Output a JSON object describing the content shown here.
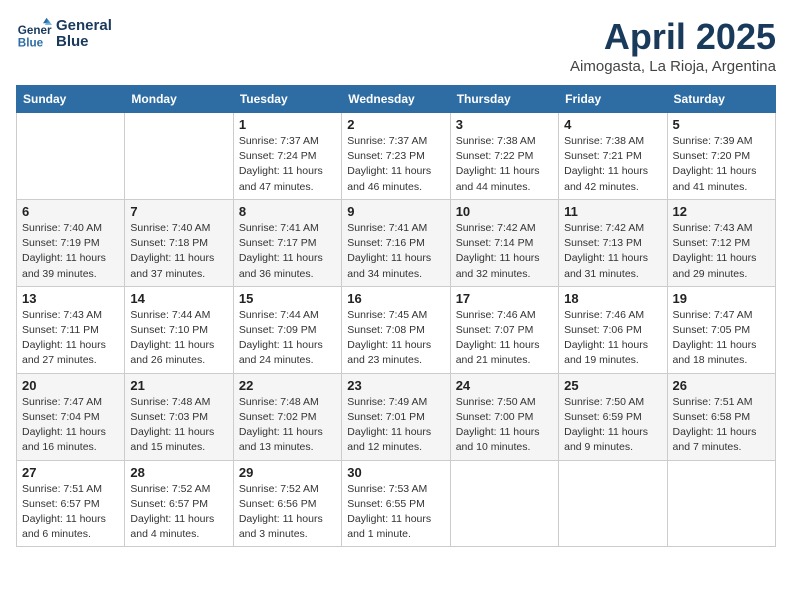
{
  "logo": {
    "line1": "General",
    "line2": "Blue"
  },
  "title": "April 2025",
  "subtitle": "Aimogasta, La Rioja, Argentina",
  "days_of_week": [
    "Sunday",
    "Monday",
    "Tuesday",
    "Wednesday",
    "Thursday",
    "Friday",
    "Saturday"
  ],
  "weeks": [
    [
      {
        "day": "",
        "info": ""
      },
      {
        "day": "",
        "info": ""
      },
      {
        "day": "1",
        "info": "Sunrise: 7:37 AM\nSunset: 7:24 PM\nDaylight: 11 hours and 47 minutes."
      },
      {
        "day": "2",
        "info": "Sunrise: 7:37 AM\nSunset: 7:23 PM\nDaylight: 11 hours and 46 minutes."
      },
      {
        "day": "3",
        "info": "Sunrise: 7:38 AM\nSunset: 7:22 PM\nDaylight: 11 hours and 44 minutes."
      },
      {
        "day": "4",
        "info": "Sunrise: 7:38 AM\nSunset: 7:21 PM\nDaylight: 11 hours and 42 minutes."
      },
      {
        "day": "5",
        "info": "Sunrise: 7:39 AM\nSunset: 7:20 PM\nDaylight: 11 hours and 41 minutes."
      }
    ],
    [
      {
        "day": "6",
        "info": "Sunrise: 7:40 AM\nSunset: 7:19 PM\nDaylight: 11 hours and 39 minutes."
      },
      {
        "day": "7",
        "info": "Sunrise: 7:40 AM\nSunset: 7:18 PM\nDaylight: 11 hours and 37 minutes."
      },
      {
        "day": "8",
        "info": "Sunrise: 7:41 AM\nSunset: 7:17 PM\nDaylight: 11 hours and 36 minutes."
      },
      {
        "day": "9",
        "info": "Sunrise: 7:41 AM\nSunset: 7:16 PM\nDaylight: 11 hours and 34 minutes."
      },
      {
        "day": "10",
        "info": "Sunrise: 7:42 AM\nSunset: 7:14 PM\nDaylight: 11 hours and 32 minutes."
      },
      {
        "day": "11",
        "info": "Sunrise: 7:42 AM\nSunset: 7:13 PM\nDaylight: 11 hours and 31 minutes."
      },
      {
        "day": "12",
        "info": "Sunrise: 7:43 AM\nSunset: 7:12 PM\nDaylight: 11 hours and 29 minutes."
      }
    ],
    [
      {
        "day": "13",
        "info": "Sunrise: 7:43 AM\nSunset: 7:11 PM\nDaylight: 11 hours and 27 minutes."
      },
      {
        "day": "14",
        "info": "Sunrise: 7:44 AM\nSunset: 7:10 PM\nDaylight: 11 hours and 26 minutes."
      },
      {
        "day": "15",
        "info": "Sunrise: 7:44 AM\nSunset: 7:09 PM\nDaylight: 11 hours and 24 minutes."
      },
      {
        "day": "16",
        "info": "Sunrise: 7:45 AM\nSunset: 7:08 PM\nDaylight: 11 hours and 23 minutes."
      },
      {
        "day": "17",
        "info": "Sunrise: 7:46 AM\nSunset: 7:07 PM\nDaylight: 11 hours and 21 minutes."
      },
      {
        "day": "18",
        "info": "Sunrise: 7:46 AM\nSunset: 7:06 PM\nDaylight: 11 hours and 19 minutes."
      },
      {
        "day": "19",
        "info": "Sunrise: 7:47 AM\nSunset: 7:05 PM\nDaylight: 11 hours and 18 minutes."
      }
    ],
    [
      {
        "day": "20",
        "info": "Sunrise: 7:47 AM\nSunset: 7:04 PM\nDaylight: 11 hours and 16 minutes."
      },
      {
        "day": "21",
        "info": "Sunrise: 7:48 AM\nSunset: 7:03 PM\nDaylight: 11 hours and 15 minutes."
      },
      {
        "day": "22",
        "info": "Sunrise: 7:48 AM\nSunset: 7:02 PM\nDaylight: 11 hours and 13 minutes."
      },
      {
        "day": "23",
        "info": "Sunrise: 7:49 AM\nSunset: 7:01 PM\nDaylight: 11 hours and 12 minutes."
      },
      {
        "day": "24",
        "info": "Sunrise: 7:50 AM\nSunset: 7:00 PM\nDaylight: 11 hours and 10 minutes."
      },
      {
        "day": "25",
        "info": "Sunrise: 7:50 AM\nSunset: 6:59 PM\nDaylight: 11 hours and 9 minutes."
      },
      {
        "day": "26",
        "info": "Sunrise: 7:51 AM\nSunset: 6:58 PM\nDaylight: 11 hours and 7 minutes."
      }
    ],
    [
      {
        "day": "27",
        "info": "Sunrise: 7:51 AM\nSunset: 6:57 PM\nDaylight: 11 hours and 6 minutes."
      },
      {
        "day": "28",
        "info": "Sunrise: 7:52 AM\nSunset: 6:57 PM\nDaylight: 11 hours and 4 minutes."
      },
      {
        "day": "29",
        "info": "Sunrise: 7:52 AM\nSunset: 6:56 PM\nDaylight: 11 hours and 3 minutes."
      },
      {
        "day": "30",
        "info": "Sunrise: 7:53 AM\nSunset: 6:55 PM\nDaylight: 11 hours and 1 minute."
      },
      {
        "day": "",
        "info": ""
      },
      {
        "day": "",
        "info": ""
      },
      {
        "day": "",
        "info": ""
      }
    ]
  ]
}
